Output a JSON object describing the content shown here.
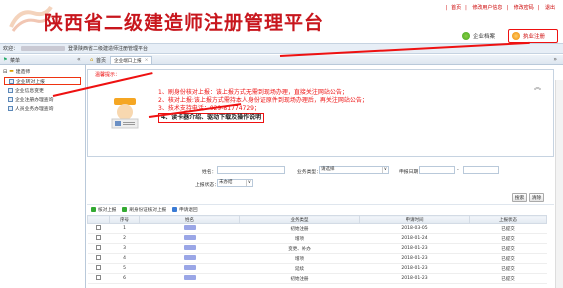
{
  "header": {
    "title_part1": "陕西省二级建造师注册管理平台",
    "toplinks": [
      "首页",
      "修改用户信息",
      "修改密码",
      "退出"
    ],
    "portal_label": "企业档案",
    "logout_label": "执业注册"
  },
  "bar1": {
    "welcome_prefix": "欢迎：",
    "welcome_text": "登录陕西省二级建造师注册管理平台"
  },
  "bar2": {
    "menu_label": "菜单",
    "home_tab": "首页",
    "tab2": "企业端口上报"
  },
  "sidebar": {
    "group": "建造师",
    "items": [
      "企业转对上报",
      "企业信息变更",
      "企业注册办理查询",
      "人员业务办理查询"
    ]
  },
  "notice": {
    "tip": "温馨提示：",
    "lines": [
      "1、刷身份核对上报：该上报方式无需到现场办理，直接关注网站公告；",
      "2、核对上报:该上报方式需持本人身份证原件到现场办理后，再关注网站公告；",
      "3、技术支持电话：029-81774729；",
      "4、读卡器介绍、驱动下载及操作说明"
    ]
  },
  "search": {
    "name_label": "姓名：",
    "company_type_label": "业务类型：",
    "company_type_value": "请选择",
    "date_label": "申报日期：",
    "date_sep": "-",
    "status_label": "上报状态：",
    "status_value": "未办结",
    "search_btn": "搜索",
    "clear_btn": "清除"
  },
  "toolbar": {
    "items": [
      "核对上报",
      "刷身份证核对上报",
      "申请退回"
    ]
  },
  "table": {
    "headers": [
      "",
      "序号",
      "姓名",
      "业务类型",
      "申请时间",
      "上报状态"
    ],
    "rows": [
      {
        "no": "1",
        "type": "初始注册",
        "date": "2018-03-05",
        "status": "已提交"
      },
      {
        "no": "2",
        "type": "增项",
        "date": "2018-01-24",
        "status": "已提交"
      },
      {
        "no": "3",
        "type": "变更、补办",
        "date": "2018-01-23",
        "status": "已提交"
      },
      {
        "no": "4",
        "type": "增项",
        "date": "2018-01-23",
        "status": "已提交"
      },
      {
        "no": "5",
        "type": "延续",
        "date": "2018-01-23",
        "status": "已提交"
      },
      {
        "no": "6",
        "type": "初始注册",
        "date": "2018-01-23",
        "status": "已提交"
      }
    ]
  },
  "colors": {
    "accent": "#e11111",
    "brand": "#c8161d"
  }
}
